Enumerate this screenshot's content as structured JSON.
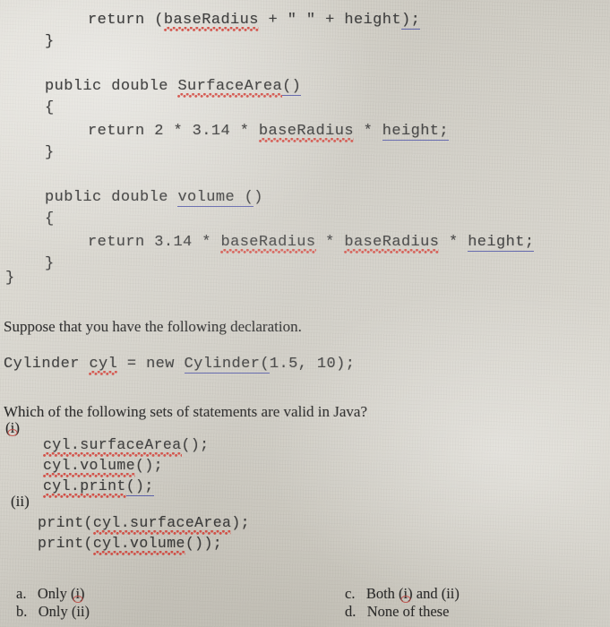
{
  "document": {
    "kind": "scanned-textbook-page",
    "paper_color": "#d7d4cb",
    "ink_color": "#2b2b2b",
    "spellcheck_underline_color": "#d2453c",
    "grammar_underline_color": "#5a5fa8"
  },
  "code_block_top": {
    "lines": [
      {
        "id": "l1",
        "text": "return (baseRadius + \" \" + height);"
      },
      {
        "id": "l2",
        "text": "}"
      },
      {
        "id": "l3",
        "text": "public double SurfaceArea()"
      },
      {
        "id": "l4",
        "text": "{"
      },
      {
        "id": "l5",
        "text": "return 2 * 3.14 * baseRadius * height;"
      },
      {
        "id": "l6",
        "text": "}"
      },
      {
        "id": "l7",
        "text": "public double volume()"
      },
      {
        "id": "l8",
        "text": "{"
      },
      {
        "id": "l9",
        "text": "return 3.14 * baseRadius * baseRadius * height;"
      },
      {
        "id": "l10",
        "text": "}"
      },
      {
        "id": "l11",
        "text": "}"
      }
    ],
    "tokens": {
      "return": "return",
      "open_paren": "(",
      "close_paren": ")",
      "baseRadius": "baseRadius",
      "plus": "+",
      "quoted_space": "\" \"",
      "height": "height",
      "height_semi": "height;",
      "close_paren_semi": ");",
      "brace_close": "}",
      "brace_open": "{",
      "public_double": "public double",
      "SurfaceArea": "SurfaceArea",
      "volume": "volume",
      "volume_paren": "volume (",
      "empty_args": "()",
      "star": "*",
      "two": "2",
      "pi": "3.14"
    }
  },
  "prose": {
    "suppose": "Suppose that you have the following declaration.",
    "question": "Which of the following sets of statements are valid in Java?"
  },
  "declaration": {
    "type": "Cylinder",
    "variable": "cyl",
    "equals": "=",
    "new_keyword": "new",
    "constructor": "Cylinder(",
    "args": "1.5, 10);"
  },
  "statement_sets": [
    {
      "marker": "(i)",
      "marker_text": "(",
      "marker_numeral": "i",
      "marker_close": ")",
      "lines": [
        {
          "prefix": "",
          "body": "cyl.surfaceArea",
          "suffix": "();"
        },
        {
          "prefix": "",
          "body": "cyl.volume",
          "suffix": "();"
        },
        {
          "prefix": "",
          "body": "cyl.print",
          "suffix": "();"
        }
      ]
    },
    {
      "marker": "(ii)",
      "lines": [
        {
          "prefix": "print(",
          "body": "cyl.surfaceArea",
          "suffix": ");"
        },
        {
          "prefix": "print(",
          "body": "cyl.volume",
          "suffix": "());"
        }
      ]
    }
  ],
  "options": {
    "left": [
      {
        "letter": "a.",
        "text": "Only (",
        "numeral": "i",
        "tail": ")"
      },
      {
        "letter": "b.",
        "text": "Only (ii)",
        "numeral": "",
        "tail": ""
      }
    ],
    "right": [
      {
        "letter": "c.",
        "text": "Both (",
        "numeral": "i",
        "tail": ") and (ii)"
      },
      {
        "letter": "d.",
        "text": "None of these",
        "numeral": "",
        "tail": ""
      }
    ]
  }
}
